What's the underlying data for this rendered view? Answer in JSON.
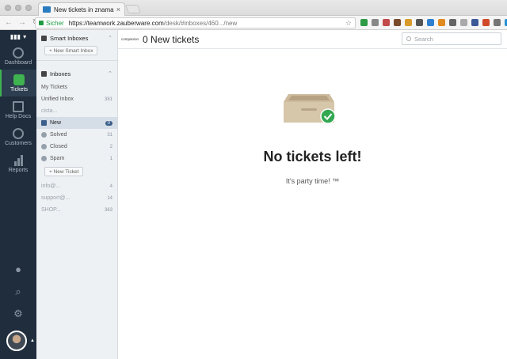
{
  "browser": {
    "tab_title": "New tickets in znamarkl...",
    "tab_close": "×",
    "secure_label": "Sicher",
    "url_host": "https://teamwork.zauberware.com",
    "url_path": "/desk/#inboxes/460...",
    "url_tail": "/new"
  },
  "rail": {
    "items": [
      {
        "label": "Dashboard"
      },
      {
        "label": "Tickets"
      },
      {
        "label": "Help Docs"
      },
      {
        "label": "Customers"
      },
      {
        "label": "Reports"
      }
    ]
  },
  "sidebar": {
    "smart_inboxes_title": "Smart Inboxes",
    "new_smart_inbox": "+ New Smart Inbox",
    "inboxes_title": "Inboxes",
    "views": [
      {
        "label": "My Tickets",
        "count": ""
      },
      {
        "label": "Unified Inbox",
        "count": "381"
      },
      {
        "label": "cista...",
        "count": ""
      }
    ],
    "statuses": [
      {
        "label": "New",
        "count": "0"
      },
      {
        "label": "Solved",
        "count": "31"
      },
      {
        "label": "Closed",
        "count": "2"
      },
      {
        "label": "Spam",
        "count": "1"
      }
    ],
    "new_ticket": "+ New Ticket",
    "other_inboxes": [
      {
        "label": "info@...",
        "count": "4"
      },
      {
        "label": "support@...",
        "count": "14"
      },
      {
        "label": "SHOP...",
        "count": "363"
      }
    ]
  },
  "main": {
    "logo_text": "companion",
    "title": "0 New tickets",
    "search_placeholder": "Search",
    "empty_title": "No tickets left!",
    "empty_sub": "It's party time! ™"
  }
}
